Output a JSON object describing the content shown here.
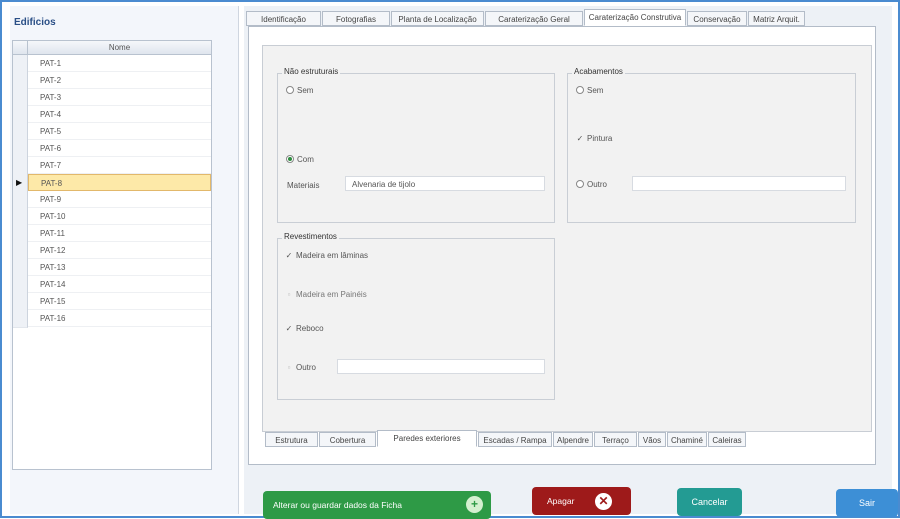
{
  "sidebar": {
    "title": "Edificios",
    "column_header": "Nome",
    "rows": [
      "PAT-1",
      "PAT-2",
      "PAT-3",
      "PAT-4",
      "PAT-5",
      "PAT-6",
      "PAT-7",
      "PAT-8",
      "PAT-9",
      "PAT-10",
      "PAT-11",
      "PAT-12",
      "PAT-13",
      "PAT-14",
      "PAT-15",
      "PAT-16"
    ],
    "selected": "PAT-8"
  },
  "top_tabs": [
    "Identificação",
    "Fotografias",
    "Planta de Localização",
    "Caraterização Geral",
    "Caraterização Construtiva",
    "Conservação",
    "Matriz Arquit."
  ],
  "top_tabs_active": "Caraterização Construtiva",
  "nao_estruturais": {
    "title": "Não estruturais",
    "sem": "Sem",
    "com": "Com",
    "material_label": "Materiais",
    "material_value": "Alvenaria de tijolo",
    "selected": "Com"
  },
  "acabamentos": {
    "title": "Acabamentos",
    "sem": "Sem",
    "pintura": "Pintura",
    "outro": "Outro",
    "outro_value": ""
  },
  "revestimentos": {
    "title": "Revestimentos",
    "madeira_laminas": "Madeira em lâminas",
    "madeira_paineis": "Madeira em Painéis",
    "reboco": "Reboco",
    "outro": "Outro",
    "outro_value": ""
  },
  "bottom_tabs": [
    "Estrutura",
    "Cobertura",
    "Paredes exteriores",
    "Escadas / Rampa",
    "Alpendre",
    "Terraço",
    "Vãos",
    "Chaminé",
    "Caleiras"
  ],
  "bottom_tabs_active": "Paredes exteriores",
  "buttons": {
    "save": "Alterar ou guardar dados da Ficha",
    "delete": "Apagar",
    "cancel": "Cancelar",
    "exit": "Sair"
  },
  "colors": {
    "save": "#2e9a46",
    "delete": "#9e1a1a",
    "cancel": "#239b93",
    "exit": "#3d8fd6",
    "selected_row": "#fde9a8"
  }
}
